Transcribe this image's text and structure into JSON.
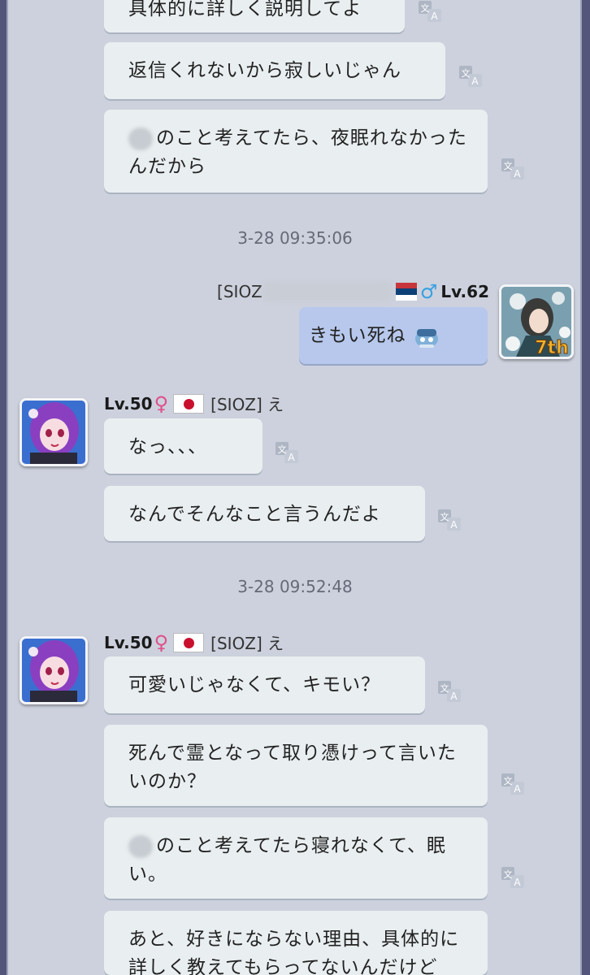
{
  "chat": {
    "messages_top": [
      {
        "text": "具体的に詳しく説明してよ"
      },
      {
        "text": "返信くれないから寂しいじゃん"
      },
      {
        "line1": "のこと考えてたら、夜眠れなかった",
        "line2": "んだから"
      }
    ],
    "timestamp_1": "3-28 09:35:06",
    "self_user": {
      "tag": "[SIOZ",
      "level": "Lv.62",
      "gender": "♂",
      "badge": "7th"
    },
    "self_message": {
      "text": "きもい死ね"
    },
    "other_user": {
      "level": "Lv.50",
      "gender": "♀",
      "tag": "[SIOZ] え"
    },
    "messages_mid": [
      {
        "text": "なっ、、、"
      },
      {
        "text": "なんでそんなこと言うんだよ"
      }
    ],
    "timestamp_2": "3-28 09:52:48",
    "messages_bottom": [
      {
        "text": "可愛いじゃなくて、キモい？"
      },
      {
        "line1": "死んで霊となって取り憑けって言いた",
        "line2": "いのか？"
      },
      {
        "line1": "のこと考えてたら寝れなくて、眠",
        "line2": "い。"
      },
      {
        "line1": "あと、好きにならない理由、具体的に",
        "line2": "詳しく教えてもらってないんだけど"
      }
    ]
  }
}
